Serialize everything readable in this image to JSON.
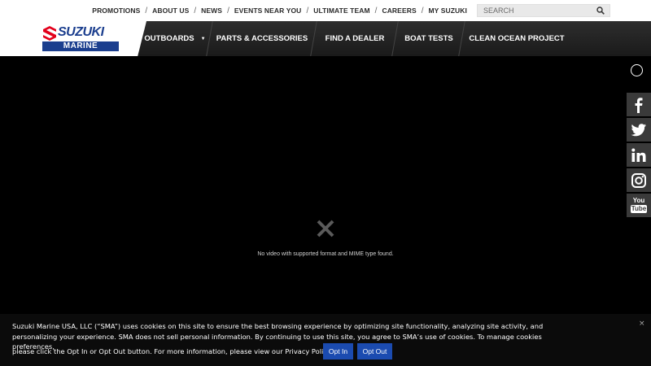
{
  "util_nav": {
    "items": [
      "PROMOTIONS",
      "ABOUT US",
      "NEWS",
      "EVENTS NEAR YOU",
      "ULTIMATE TEAM",
      "CAREERS",
      "MY SUZUKI"
    ],
    "separator": "/"
  },
  "search": {
    "placeholder": "SEARCH"
  },
  "logo": {
    "brand": "SUZUKI",
    "sub": "MARINE"
  },
  "main_nav": {
    "items": [
      {
        "label": "OUTBOARDS",
        "caret": "▼"
      },
      {
        "label": "PARTS & ACCESSORIES"
      },
      {
        "label": "FIND A DEALER"
      },
      {
        "label": "BOAT TESTS"
      },
      {
        "label": "CLEAN OCEAN PROJECT"
      }
    ]
  },
  "video": {
    "error_message": "No video with supported format and MIME type found."
  },
  "social": {
    "items": [
      "facebook",
      "twitter",
      "linkedin",
      "instagram",
      "youtube"
    ],
    "youtube_label_top": "You",
    "youtube_label_bottom": "Tube"
  },
  "cookie": {
    "text": "Suzuki Marine USA, LLC (“SMA”) uses cookies on this site to ensure the best browsing experience by optimizing site functionality, analyzing site activity, and personalizing your experience. SMA does not sell personal information. By continuing to use this site, you agree to SMA’s use of cookies. To manage cookies preferences,",
    "text_line3": "please click the Opt In or Opt Out button. For more information, please view our Privacy Policy.",
    "opt_in": "Opt In",
    "opt_out": "Opt Out",
    "close": "×"
  },
  "colors": {
    "brand_blue": "#1b3e8e",
    "button_blue": "#1b4bb0",
    "header_dark": "#222222"
  }
}
